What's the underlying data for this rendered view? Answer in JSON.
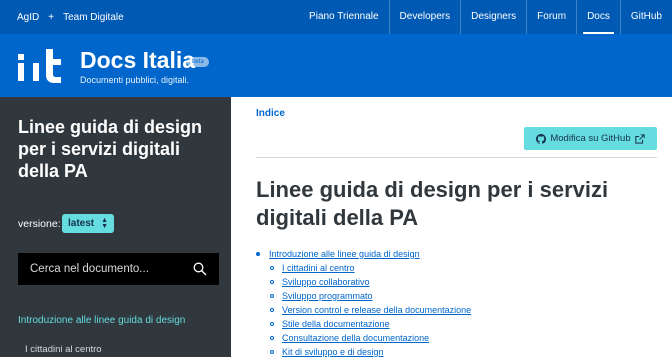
{
  "topbar": {
    "left": [
      "AgID",
      "+",
      "Team Digitale"
    ],
    "right": [
      {
        "label": "Piano Triennale",
        "active": false
      },
      {
        "label": "Developers",
        "active": false
      },
      {
        "label": "Designers",
        "active": false
      },
      {
        "label": "Forum",
        "active": false
      },
      {
        "label": "Docs",
        "active": true
      },
      {
        "label": "GitHub",
        "active": false
      }
    ]
  },
  "header": {
    "title": "Docs Italia",
    "badge": "beta",
    "subtitle": "Documenti pubblici, digitali."
  },
  "sidebar": {
    "title": "Linee guida di design per i servizi digitali della PA",
    "version_label": "versione:",
    "version_value": "latest",
    "search_placeholder": "Cerca nel documento...",
    "active_link": "Introduzione alle linee guida di design",
    "items": [
      "I cittadini al centro"
    ]
  },
  "main": {
    "indice": "Indice",
    "github_button": "Modifica su GitHub",
    "title": "Linee guida di design per i servizi digitali della PA",
    "toc": {
      "top": "Introduzione alle linee guida di design",
      "children": [
        "I cittadini al centro",
        "Sviluppo collaborativo",
        "Sviluppo programmato",
        "Version control e release della documentazione",
        "Stile della documentazione",
        "Consultazione della documentazione",
        "Kit di sviluppo e di design"
      ]
    }
  },
  "colors": {
    "topbar": "#0059b3",
    "header": "#0066cc",
    "sidebar": "#30373d",
    "accent": "#65dcdf",
    "link": "#0066cc"
  },
  "icons": [
    "github-icon",
    "external-link-icon",
    "search-icon",
    "select-arrows-icon"
  ]
}
